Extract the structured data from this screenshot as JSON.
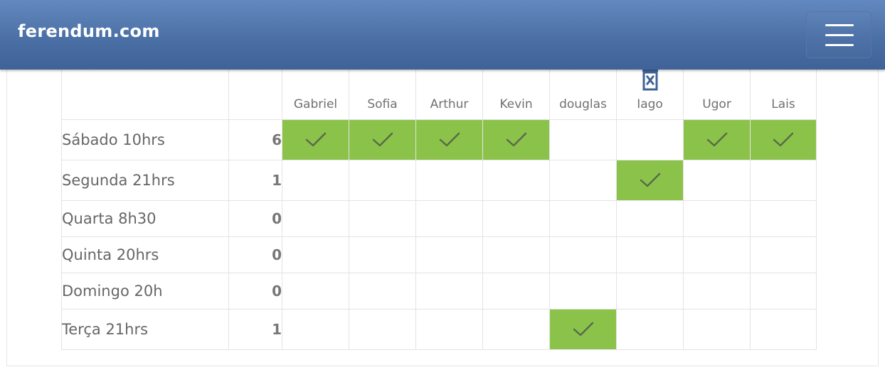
{
  "header": {
    "brand": "ferendum.com",
    "menu_icon": "hamburger-menu-icon"
  },
  "participants": [
    "Gabriel",
    "Sofia",
    "Arthur",
    "Kevin",
    "douglas",
    "Iago",
    "Ugor",
    "Lais"
  ],
  "delete_icon_participant": "Iago",
  "colors": {
    "yes": "#8bc34a",
    "navbar_top": "#6289bf",
    "navbar_bottom": "#3f6398"
  },
  "rows": [
    {
      "label": "Sábado 10hrs",
      "count": "6",
      "votes": [
        true,
        true,
        true,
        true,
        false,
        false,
        true,
        true
      ]
    },
    {
      "label": "Segunda 21hrs",
      "count": "1",
      "votes": [
        false,
        false,
        false,
        false,
        false,
        true,
        false,
        false
      ]
    },
    {
      "label": "Quarta 8h30",
      "count": "0",
      "votes": [
        false,
        false,
        false,
        false,
        false,
        false,
        false,
        false
      ]
    },
    {
      "label": "Quinta 20hrs",
      "count": "0",
      "votes": [
        false,
        false,
        false,
        false,
        false,
        false,
        false,
        false
      ]
    },
    {
      "label": "Domingo 20h",
      "count": "0",
      "votes": [
        false,
        false,
        false,
        false,
        false,
        false,
        false,
        false
      ]
    },
    {
      "label": "Terça 21hrs",
      "count": "1",
      "votes": [
        false,
        false,
        false,
        false,
        true,
        false,
        false,
        false
      ]
    }
  ]
}
